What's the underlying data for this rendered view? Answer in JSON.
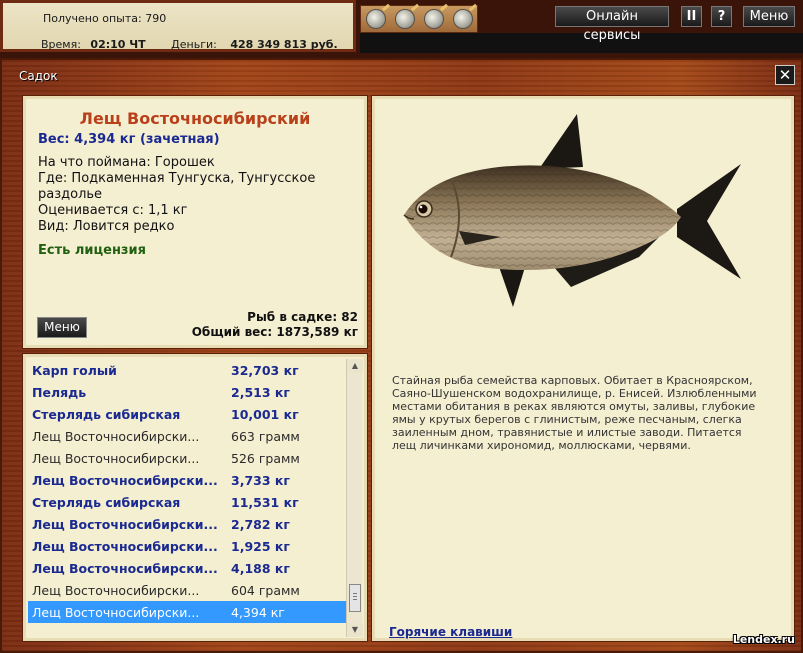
{
  "hud": {
    "exp_label": "Получено опыта:",
    "exp_value": "790",
    "time_label": "Время:",
    "time_value": "02:10 ЧТ",
    "money_label": "Деньги:",
    "money_value": "428 349 813 руб.",
    "online_services": "Онлайн сервисы",
    "pause": "II",
    "help": "?",
    "menu": "Меню"
  },
  "window": {
    "title": "Садок",
    "close": "✕"
  },
  "fish_info": {
    "name": "Лещ Восточносибирский",
    "weight": "Вес: 4,394 кг (зачетная)",
    "bait": "На что поймана: Горошек",
    "location": "Где: Подкаменная Тунгуска, Тунгусское раздолье",
    "value": "Оценивается с: 1,1 кг",
    "kind": "Вид: Ловится редко",
    "license": "Есть лицензия",
    "menu_button": "Меню",
    "keep_count": "Рыб в садке: 82",
    "keep_total": "Общий вес: 1873,589 кг"
  },
  "fish_list": [
    {
      "name": "Карп голый",
      "weight": "32,703 кг",
      "state": "caught"
    },
    {
      "name": "Пелядь",
      "weight": "2,513 кг",
      "state": "caught"
    },
    {
      "name": "Стерлядь сибирская",
      "weight": "10,001 кг",
      "state": "caught"
    },
    {
      "name": "Лещ Восточносибирски...",
      "weight": "663 грамм",
      "state": "released"
    },
    {
      "name": "Лещ Восточносибирски...",
      "weight": "526 грамм",
      "state": "released"
    },
    {
      "name": "Лещ Восточносибирски...",
      "weight": "3,733 кг",
      "state": "caught"
    },
    {
      "name": "Стерлядь сибирская",
      "weight": "11,531 кг",
      "state": "caught"
    },
    {
      "name": "Лещ Восточносибирски...",
      "weight": "2,782 кг",
      "state": "caught"
    },
    {
      "name": "Лещ Восточносибирски...",
      "weight": "1,925 кг",
      "state": "caught"
    },
    {
      "name": "Лещ Восточносибирски...",
      "weight": "4,188 кг",
      "state": "caught"
    },
    {
      "name": "Лещ Восточносибирски...",
      "weight": "604 грамм",
      "state": "released"
    },
    {
      "name": "Лещ Восточносибирски...",
      "weight": "4,394 кг",
      "state": "selected"
    }
  ],
  "description": "Стайная рыба семейства карповых. Обитает в Красноярском, Саяно-Шушенском  водохранилище, р. Енисей. Излюбленными местами обитания в реках являются омуты, заливы, глубокие ямы у крутых берегов с глинистым, реже песчаным, слегка заиленным дном, травянистые и илистые заводи. Питается лещ личинками хирономид, моллюсками, червями.",
  "hotkeys": "Горячие клавиши",
  "watermark": "Lendex.ru",
  "icons": {
    "bait_items": [
      "bait-icon",
      "bait-icon",
      "bait-icon",
      "bait-icon"
    ],
    "scroll_up": "▲",
    "scroll_down": "▼"
  },
  "colors": {
    "fish_name": "#b8401a",
    "caught_text": "#1a2a90",
    "license": "#206010",
    "selected_row": "#3399ff",
    "wood": "#a24418"
  }
}
